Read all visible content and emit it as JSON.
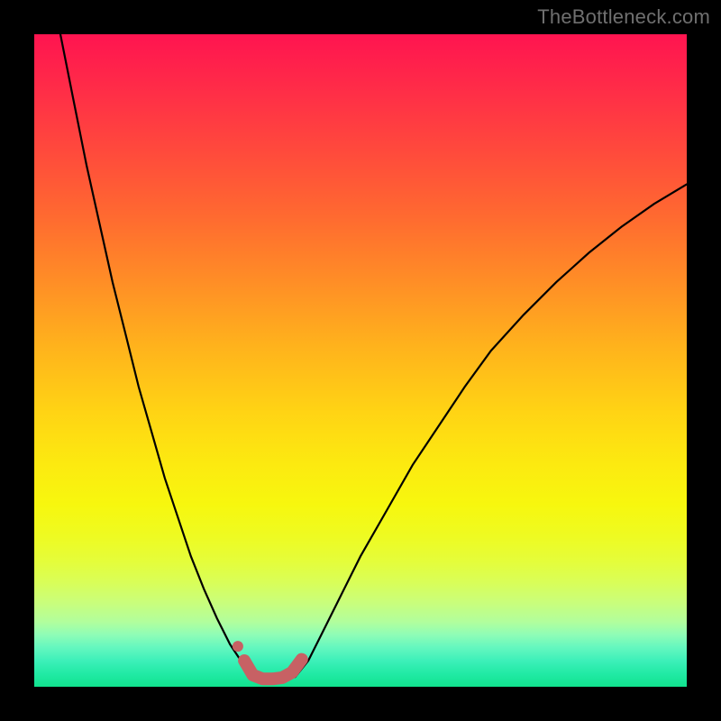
{
  "watermark": "TheBottleneck.com",
  "colors": {
    "marker": "#c76164",
    "curve": "#000000",
    "frame": "#000000"
  },
  "chart_data": {
    "type": "line",
    "title": "",
    "xlabel": "",
    "ylabel": "",
    "xlim": [
      0,
      100
    ],
    "ylim": [
      0,
      100
    ],
    "grid": false,
    "legend": false,
    "series": [
      {
        "name": "left-curve",
        "x": [
          4,
          6,
          8,
          10,
          12,
          14,
          16,
          18,
          20,
          22,
          24,
          26,
          28,
          30,
          32,
          33.5
        ],
        "y": [
          100,
          90,
          80,
          71,
          62,
          54,
          46,
          39,
          32,
          26,
          20,
          15,
          10.5,
          6.5,
          3.5,
          1.5
        ]
      },
      {
        "name": "right-curve",
        "x": [
          40,
          42,
          44,
          47,
          50,
          54,
          58,
          62,
          66,
          70,
          75,
          80,
          85,
          90,
          95,
          100
        ],
        "y": [
          1.5,
          4,
          8,
          14,
          20,
          27,
          34,
          40,
          46,
          51.5,
          57,
          62,
          66.5,
          70.5,
          74,
          77
        ]
      },
      {
        "name": "highlight-path",
        "x": [
          32.2,
          33.5,
          35,
          36.5,
          38,
          39.5,
          41
        ],
        "y": [
          4.0,
          1.8,
          1.2,
          1.2,
          1.4,
          2.2,
          4.2
        ]
      }
    ],
    "markers": [
      {
        "name": "highlight-dot",
        "x": 31.2,
        "y": 6.2
      }
    ],
    "background_gradient": "vertical rainbow red→yellow→green"
  }
}
